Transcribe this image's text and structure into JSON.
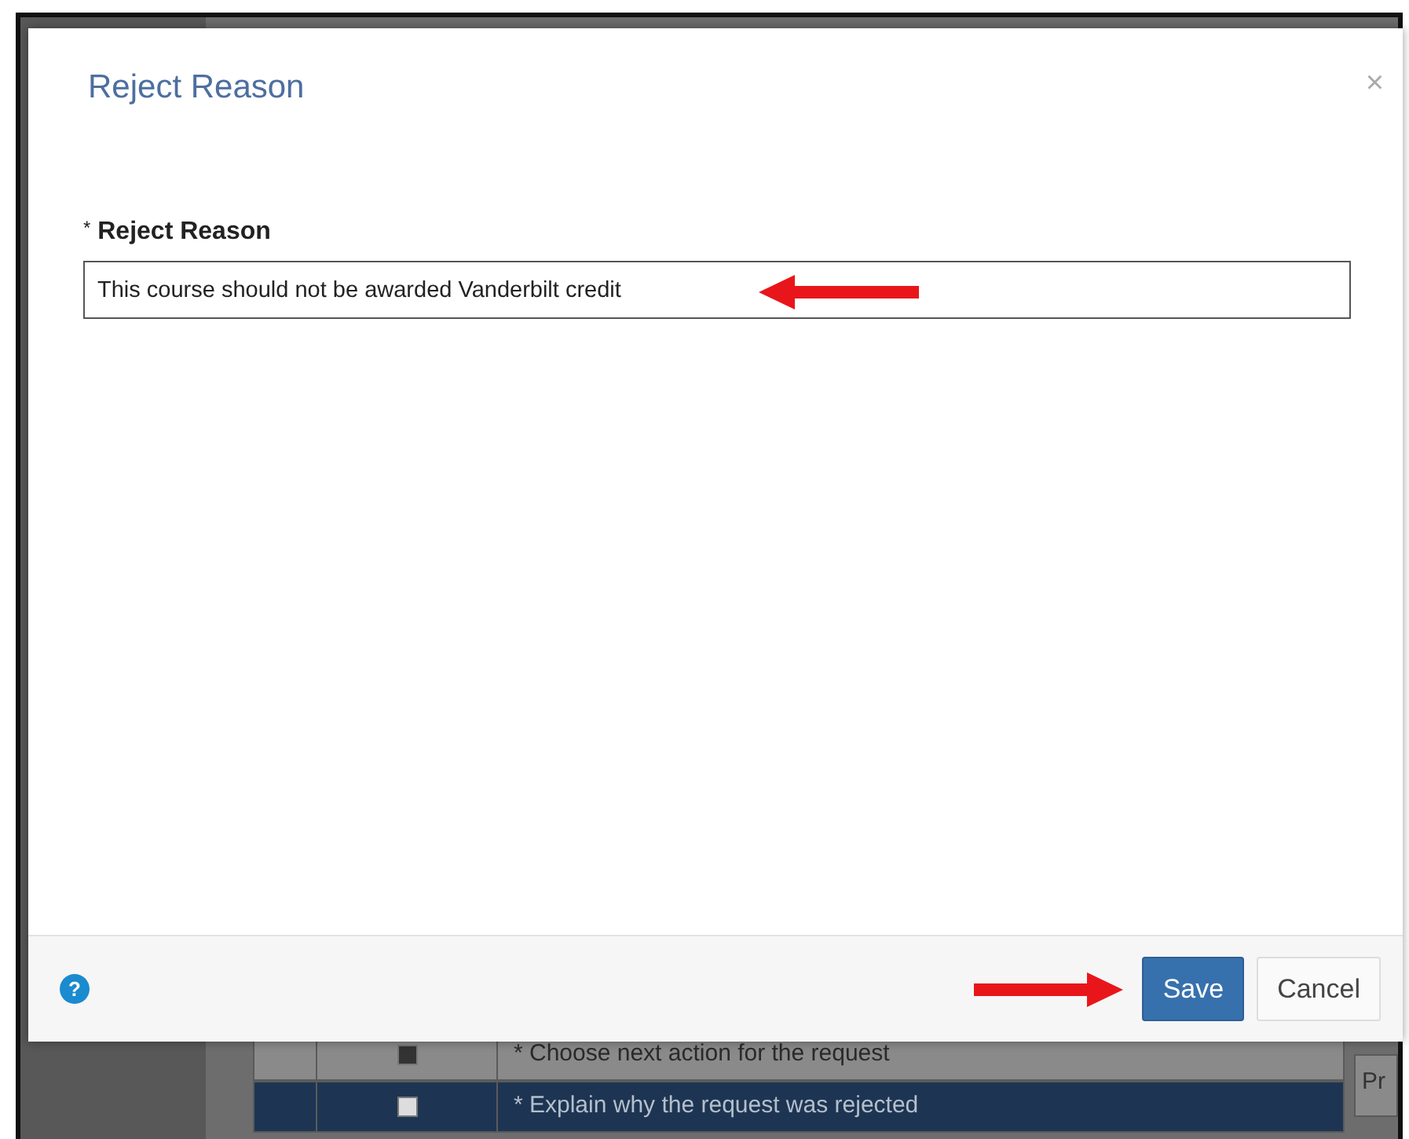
{
  "dialog": {
    "title": "Reject Reason",
    "close": "×",
    "field": {
      "required_mark": "*",
      "label": "Reject Reason",
      "value": "This course should not be awarded Vanderbilt credit"
    },
    "help": "?",
    "buttons": [
      {
        "label": "Save",
        "kind": "primary"
      },
      {
        "label": "Cancel",
        "kind": "secondary"
      }
    ]
  },
  "background_table": {
    "rows": [
      {
        "text": "* Choose next action for the request",
        "checked": true,
        "selected": false
      },
      {
        "text": "* Explain why the request was rejected",
        "checked": false,
        "selected": true
      }
    ]
  },
  "side_text": "Pr"
}
